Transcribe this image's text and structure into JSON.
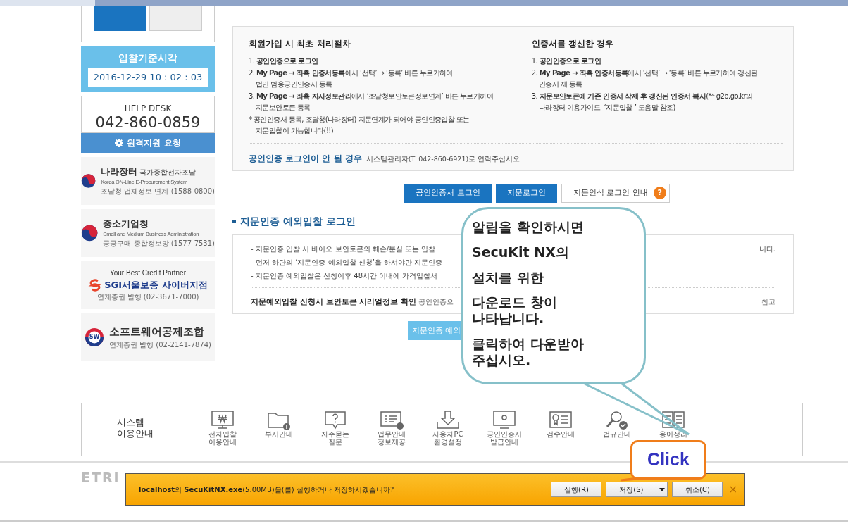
{
  "sidebar": {
    "time_title": "입찰기준시각",
    "time_value": "2016-12-29 10 : 02 : 03",
    "help_title": "HELP DESK",
    "help_phone": "042-860-0859",
    "remote_button": "원격지원 요청",
    "partners": [
      {
        "name": "나라장터",
        "tag": "국가종합전자조달",
        "subtitle": "Korea ON-Line E-Procurement System",
        "info": "조달청 업체정보 연계 (1588-0800)"
      },
      {
        "name": "중소기업청",
        "subtitle": "Small and Medium Business Administration",
        "info": "공공구매 종합정보망 (1577-7531)"
      },
      {
        "tag": "Your Best Credit Partner",
        "name": "SGI서울보증 사이버지점",
        "info": "연계증권 발행 (02-3671-7000)"
      },
      {
        "name": "소프트웨어공제조합",
        "logo_text": "SW",
        "info": "연계증권 발행 (02-2141-7874)"
      }
    ]
  },
  "info": {
    "columns": [
      {
        "title": "회원가입 시 최초 처리절차",
        "items": [
          {
            "num": "1.",
            "bold": "공인인증으로 로그인"
          },
          {
            "num": "2.",
            "bold": "My Page → 좌측 인증서등록",
            "text": "에서 ‘선택’ → ‘등록’ 버튼 누르기하여\n법인 범용공인인증서 등록"
          },
          {
            "num": "3.",
            "bold": "My Page → 좌측 자사정보관리",
            "text": "에서 ‘조달청보안토큰정보연계’ 버튼 누르기하여\n지문보안토큰 등록"
          },
          {
            "num": "*",
            "text": "공인인증서 등록, 조달청(나라장터) 지문연계가 되어야 공인인증입찰 또는\n지문입찰이 가능합니다(!!)"
          }
        ]
      },
      {
        "title": "인증서를 갱신한 경우",
        "items": [
          {
            "num": "1.",
            "bold": "공인인증으로 로그인"
          },
          {
            "num": "2.",
            "bold": "My Page → 좌측 인증서등록",
            "text": "에서 ‘선택’ → ‘등록’ 버튼 누르기하여 갱신된\n인증서 재 등록"
          },
          {
            "num": "3.",
            "bold": "지문보안토큰에 기존 인증서 삭제 후 갱신된 인증서 복사",
            "text": "(** g2b.go.kr의\n나라장터 이용가이드 -‘지문입찰-’ 도움말 참조)"
          }
        ]
      }
    ],
    "note_title": "공인인증 로그인이 안 될 경우",
    "note_text": "시스템관리자(T. 042-860-6921)로 연락주십시오."
  },
  "login_buttons": [
    {
      "label": "공인인증서 로그인",
      "kind": "primary"
    },
    {
      "label": "지문로그인",
      "kind": "primary"
    },
    {
      "label": "지문인식 로그인 안내",
      "kind": "help",
      "badge": "?"
    }
  ],
  "exception": {
    "title": "지문인증 예외입찰 로그인",
    "lines": [
      {
        "left": "- 지문인증 입찰 시 바이오 보안토큰의 훼손/분실 또는 입찰",
        "right": "니다."
      },
      {
        "left": "- 먼저 하단의 ‘지문인증 예외입찰 신청’을 하셔야만 지문인증"
      },
      {
        "left": "- 지문인증 예외입찰은 신청이후 48시간 이내에 가격입찰서"
      }
    ],
    "serial_title": "지문예외입찰 신청시 보안토큰 시리얼정보 확인",
    "serial_left": "공인인증으",
    "serial_right": "참고",
    "button": "지문인증 예외"
  },
  "guide": {
    "title": "시스템\n이용안내",
    "items": [
      "전자입찰\n이용안내",
      "부서안내",
      "자주묻는\n질문",
      "업무안내\n정보제공",
      "사용자PC\n환경설정",
      "공인인증서\n발급안내",
      "검수안내",
      "법규안내",
      "용어정리"
    ]
  },
  "footer": {
    "logo": "ETRI"
  },
  "callout": {
    "lines": [
      "알림을 확인하시면",
      "SecuKit NX의",
      "설치를 위한",
      "다운로드 창이 나타납니다.",
      "클릭하여 다운받아 주십시오."
    ]
  },
  "click_callout": "Click",
  "download_bar": {
    "message": "**localhost**의 **SecuKitNX.exe**(5.00MB)을(를) 실행하거나 저장하시겠습니까?",
    "buttons": [
      {
        "label": "실행(R)",
        "kind": "plain"
      },
      {
        "label": "저장(S)",
        "kind": "split"
      },
      {
        "label": "취소(C)",
        "kind": "plain"
      }
    ],
    "close": "×"
  }
}
